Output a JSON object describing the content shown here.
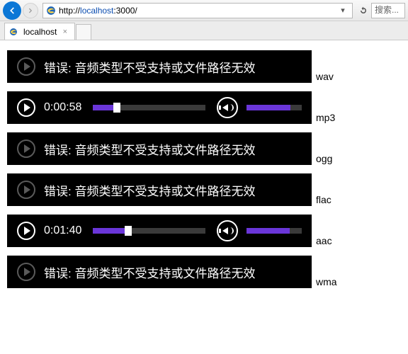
{
  "browser": {
    "url_prefix": "http://",
    "url_host": "localhost",
    "url_port": ":3000/",
    "search_placeholder": "搜索...",
    "tab_title": "localhost"
  },
  "error_message": "错误: 音频类型不受支持或文件路径无效",
  "players": [
    {
      "kind": "error",
      "format": "wav"
    },
    {
      "kind": "play",
      "format": "mp3",
      "time": "0:00:58",
      "progress_pct": 18,
      "volume_pct": 80
    },
    {
      "kind": "error",
      "format": "ogg"
    },
    {
      "kind": "error",
      "format": "flac"
    },
    {
      "kind": "play",
      "format": "aac",
      "time": "0:01:40",
      "progress_pct": 28,
      "volume_pct": 78
    },
    {
      "kind": "error",
      "format": "wma"
    }
  ]
}
